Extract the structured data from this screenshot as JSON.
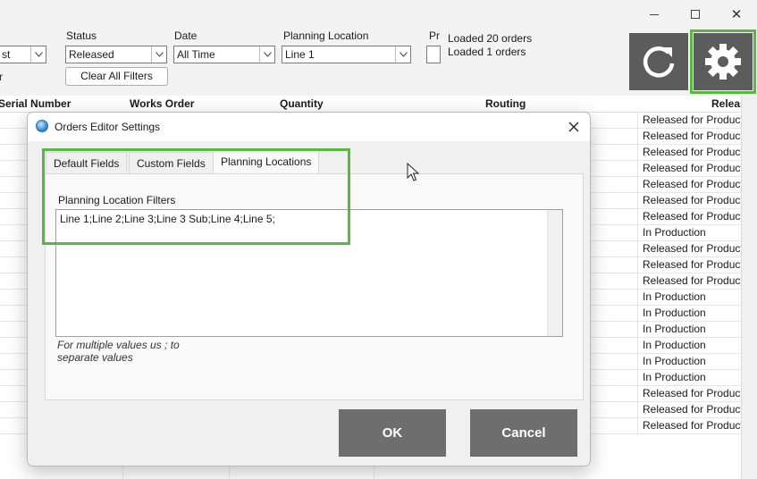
{
  "window": {
    "close_glyph": "✕"
  },
  "filters": {
    "first_value": "st",
    "status_label": "Status",
    "status_value": "Released",
    "date_label": "Date",
    "date_value": "All Time",
    "location_label": "Planning Location",
    "location_value": "Line 1",
    "partial_label": "Pr",
    "clear_label": "Clear All Filters",
    "left_partial": "r"
  },
  "status_text": {
    "loaded_orders": "Loaded 20 orders",
    "loaded_orders2": "Loaded 1 orders"
  },
  "icons": {
    "refresh": "refresh-icon",
    "settings": "gear-icon"
  },
  "grid": {
    "headers": {
      "serial": "Serial Number",
      "works_order": "Works Order",
      "quantity": "Quantity",
      "routing": "Routing",
      "release": "Releas"
    },
    "rows": [
      "Released for Production",
      "Released for Production",
      "Released for Production",
      "Released for Production",
      "Released for Production",
      "Released for Production",
      "Released for Production",
      "In Production",
      "Released for Production",
      "Released for Production",
      "Released for Production",
      "In Production",
      "In Production",
      "In Production",
      "In Production",
      "In Production",
      "In Production",
      "Released for Production",
      "Released for Production",
      "Released for Production"
    ]
  },
  "dialog": {
    "title": "Orders Editor Settings",
    "tabs": [
      "Default Fields",
      "Custom Fields",
      "Planning Locations"
    ],
    "field_label": "Planning Location Filters",
    "field_value": "Line 1;Line 2;Line 3;Line 3 Sub;Line 4;Line 5;",
    "hint_line1": "For multiple values us ; to",
    "hint_line2": "separate values",
    "ok_label": "OK",
    "cancel_label": "Cancel"
  },
  "colors": {
    "highlight": "#59b840",
    "button_dark": "#5c5c5c",
    "dialog_button": "#6e6e6e"
  }
}
